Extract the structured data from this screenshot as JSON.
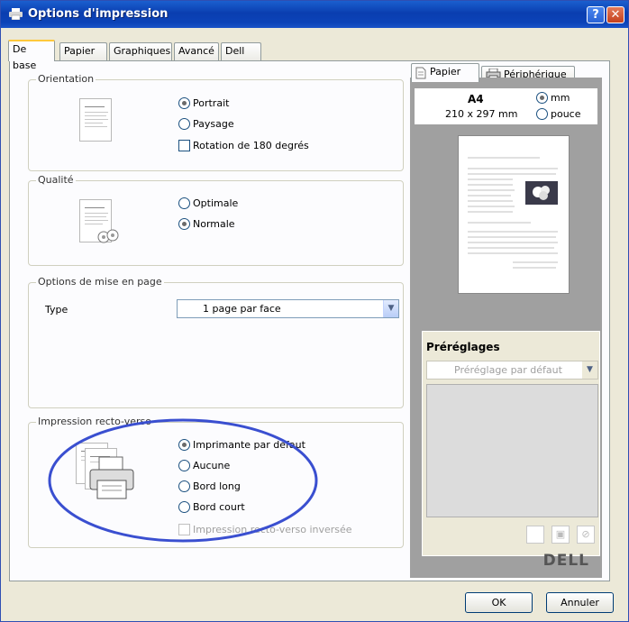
{
  "window": {
    "title": "Options d'impression",
    "help_label": "?",
    "close_label": "✕"
  },
  "tabs": [
    "De base",
    "Papier",
    "Graphiques",
    "Avancé",
    "Dell"
  ],
  "orientation": {
    "title": "Orientation",
    "options": [
      "Portrait",
      "Paysage"
    ],
    "selected": "Portrait",
    "rotate_label": "Rotation de 180 degrés"
  },
  "quality": {
    "title": "Qualité",
    "options": [
      "Optimale",
      "Normale"
    ],
    "selected": "Normale"
  },
  "layout": {
    "title": "Options de mise en page",
    "type_label": "Type",
    "type_value": "1 page par face"
  },
  "duplex": {
    "title": "Impression recto-verso",
    "options": [
      "Imprimante par défaut",
      "Aucune",
      "Bord long",
      "Bord court"
    ],
    "selected": "Imprimante par défaut",
    "reverse_label": "Impression recto-verso inversée"
  },
  "preview": {
    "tabs": [
      "Papier",
      "Périphérique"
    ],
    "paper_name": "A4",
    "paper_size": "210 x 297 mm",
    "units": [
      "mm",
      "pouce"
    ],
    "selected_unit": "mm"
  },
  "presets": {
    "title": "Préréglages",
    "value": "Préréglage par défaut"
  },
  "brand": "DELL",
  "buttons": {
    "ok": "OK",
    "cancel": "Annuler"
  },
  "annotation_color": "#3a4fd0"
}
